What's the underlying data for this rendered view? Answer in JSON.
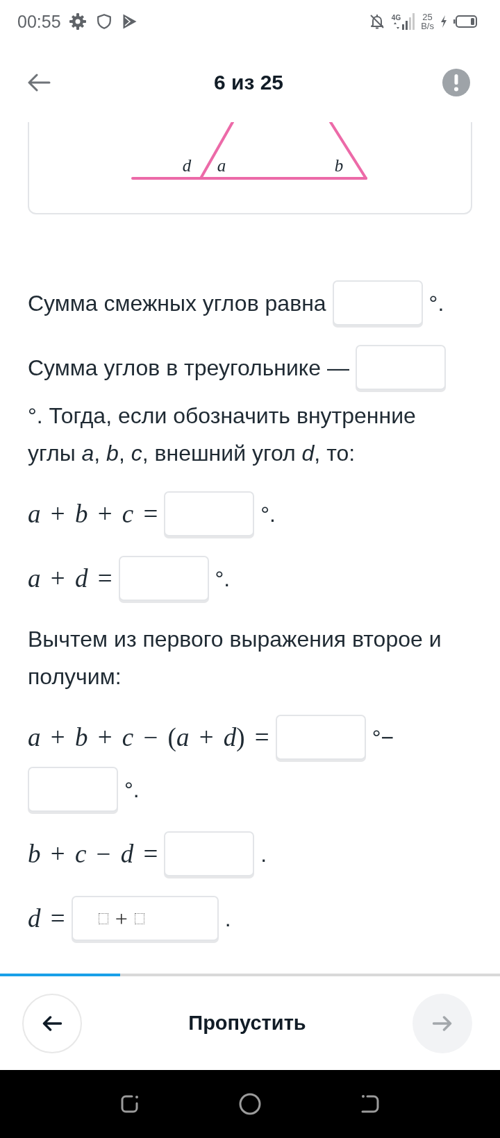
{
  "status_bar": {
    "time": "00:55",
    "network_type": "4G",
    "speed_value": "25",
    "speed_unit": "B/s"
  },
  "header": {
    "title": "6 из 25"
  },
  "figure": {
    "labels": [
      {
        "text": "d"
      },
      {
        "text": "a"
      },
      {
        "text": "b"
      }
    ]
  },
  "exercise": [
    {
      "items": [
        {
          "kind": "text",
          "text": "Сумма смежных углов равна"
        },
        {
          "kind": "blank"
        },
        {
          "kind": "text",
          "text": "°."
        }
      ]
    },
    {
      "items": [
        {
          "kind": "text",
          "text": "Сумма углов в треугольнике —"
        },
        {
          "kind": "blank"
        },
        {
          "kind": "text",
          "text": "°. Тогда, если обозначить внутренние углы *a*, *b*, *c*, внешний угол *d*, то:"
        }
      ]
    },
    {
      "items": [
        {
          "kind": "math",
          "text": "*a* + *b* + *c* ="
        },
        {
          "kind": "blank"
        },
        {
          "kind": "text",
          "text": "°."
        }
      ]
    },
    {
      "items": [
        {
          "kind": "math",
          "text": "*a* + *d* ="
        },
        {
          "kind": "blank"
        },
        {
          "kind": "text",
          "text": "°."
        }
      ]
    },
    {
      "items": [
        {
          "kind": "text",
          "text": "Вычтем из первого выражения второе и получим:"
        }
      ]
    },
    {
      "items": [
        {
          "kind": "math",
          "text": "*a* + *b* + *c* − (*a* + *d*) ="
        },
        {
          "kind": "blank"
        },
        {
          "kind": "text",
          "text": "°−"
        },
        {
          "kind": "blank"
        },
        {
          "kind": "text",
          "text": "°."
        }
      ]
    },
    {
      "items": [
        {
          "kind": "math",
          "text": "*b* + *c* − *d* ="
        },
        {
          "kind": "blank"
        },
        {
          "kind": "text",
          "text": "."
        }
      ]
    },
    {
      "items": [
        {
          "kind": "math",
          "text": "*d* ="
        },
        {
          "kind": "blank",
          "template": [
            {
              "kind": "slot"
            },
            {
              "kind": "text",
              "text": "+"
            },
            {
              "kind": "slot"
            }
          ]
        },
        {
          "kind": "text",
          "text": "."
        }
      ]
    }
  ],
  "progress": {
    "level": 0.24
  },
  "footer": {
    "skip_label": "Пропустить",
    "next_disabled": true
  }
}
